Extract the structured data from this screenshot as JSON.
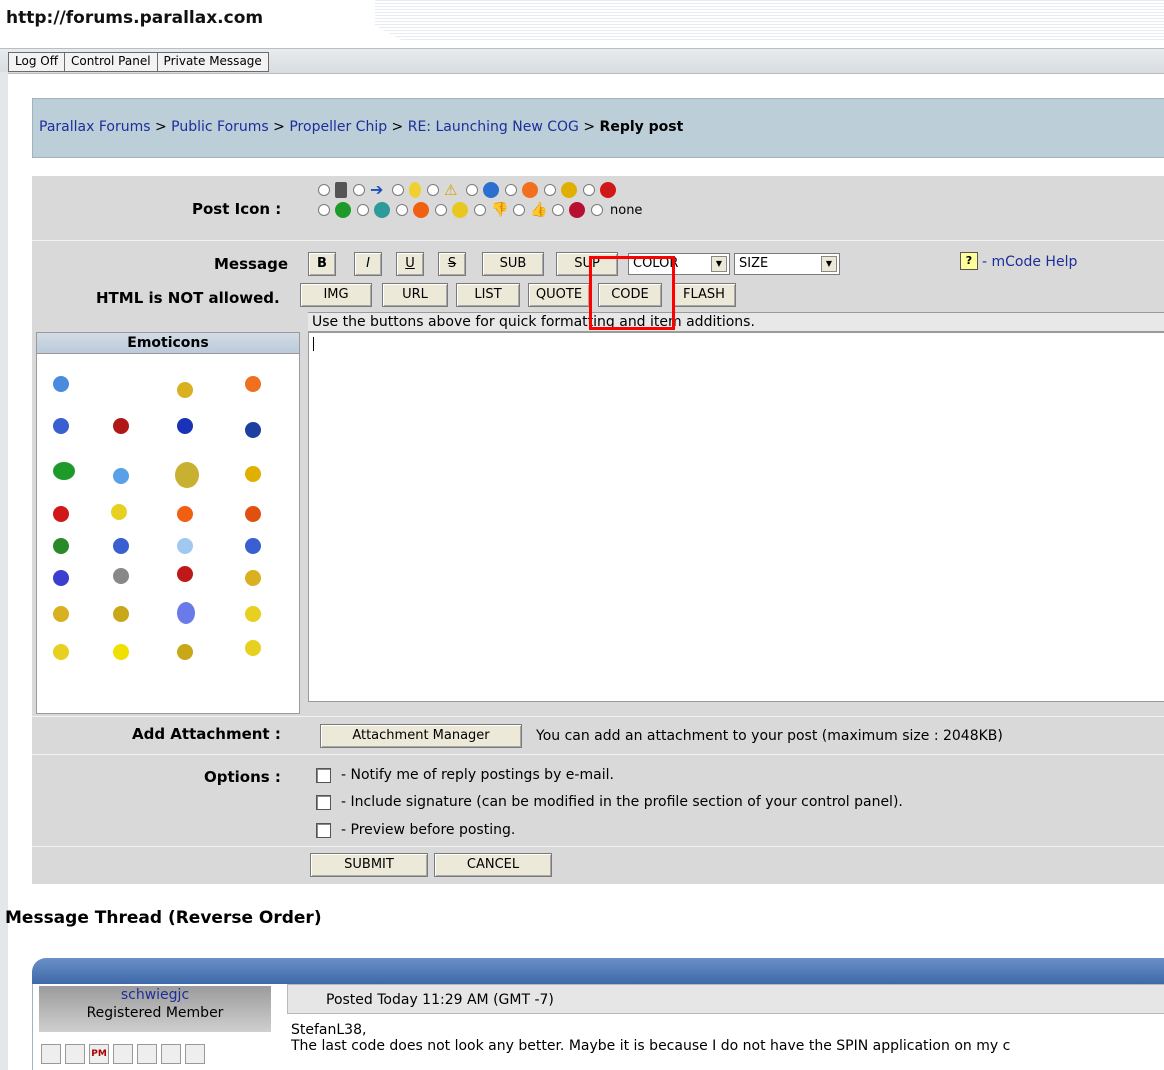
{
  "browser": {
    "url": "http://forums.parallax.com"
  },
  "topbar": {
    "items": [
      "Log Off",
      "Control Panel",
      "Private Message"
    ]
  },
  "breadcrumb": {
    "links": [
      "Parallax Forums",
      "Public Forums",
      "Propeller Chip",
      "RE: Launching New COG"
    ],
    "separator": ">",
    "current": "Reply post"
  },
  "form": {
    "post_icon_label": "Post Icon :",
    "none_label": "none",
    "message_label": "Message",
    "html_note": "HTML is NOT allowed.",
    "buttons_row1": [
      "B",
      "I",
      "U",
      "S",
      "SUB",
      "SUP"
    ],
    "color_select": "COLOR",
    "size_select": "SIZE",
    "help_link": "- mCode Help",
    "buttons_row2": [
      "IMG",
      "URL",
      "LIST",
      "QUOTE",
      "CODE",
      "FLASH"
    ],
    "hint": "Use the buttons above for quick formatting and item additions.",
    "emoticons_header": "Emoticons",
    "attach_label": "Add Attachment :",
    "attach_button": "Attachment Manager",
    "attach_text": "You can add an attachment to your post (maximum size : 2048KB)",
    "options_label": "Options :",
    "options": [
      "- Notify me of reply postings by e-mail.",
      "- Include signature (can be modified in the profile section of your control panel).",
      "- Preview before posting."
    ],
    "submit": "SUBMIT",
    "cancel": "CANCEL"
  },
  "thread": {
    "title": "Message Thread (Reverse Order)",
    "author_name": "schwiegjc",
    "author_rank": "Registered Member",
    "posted": "Posted Today 11:29 AM (GMT -7)",
    "body_line1": "StefanL38,",
    "body_line2": "The last code does not look any better. Maybe it is because I do not have the SPIN application on my c",
    "author_icon_pm": "PM"
  },
  "colors": {
    "breadcrumb_bg": "#bccfd9",
    "form_bg": "#d9d9d9",
    "link": "#1d2e9b",
    "highlight": "#ff0000",
    "thread_bar": "#3e69a8"
  }
}
